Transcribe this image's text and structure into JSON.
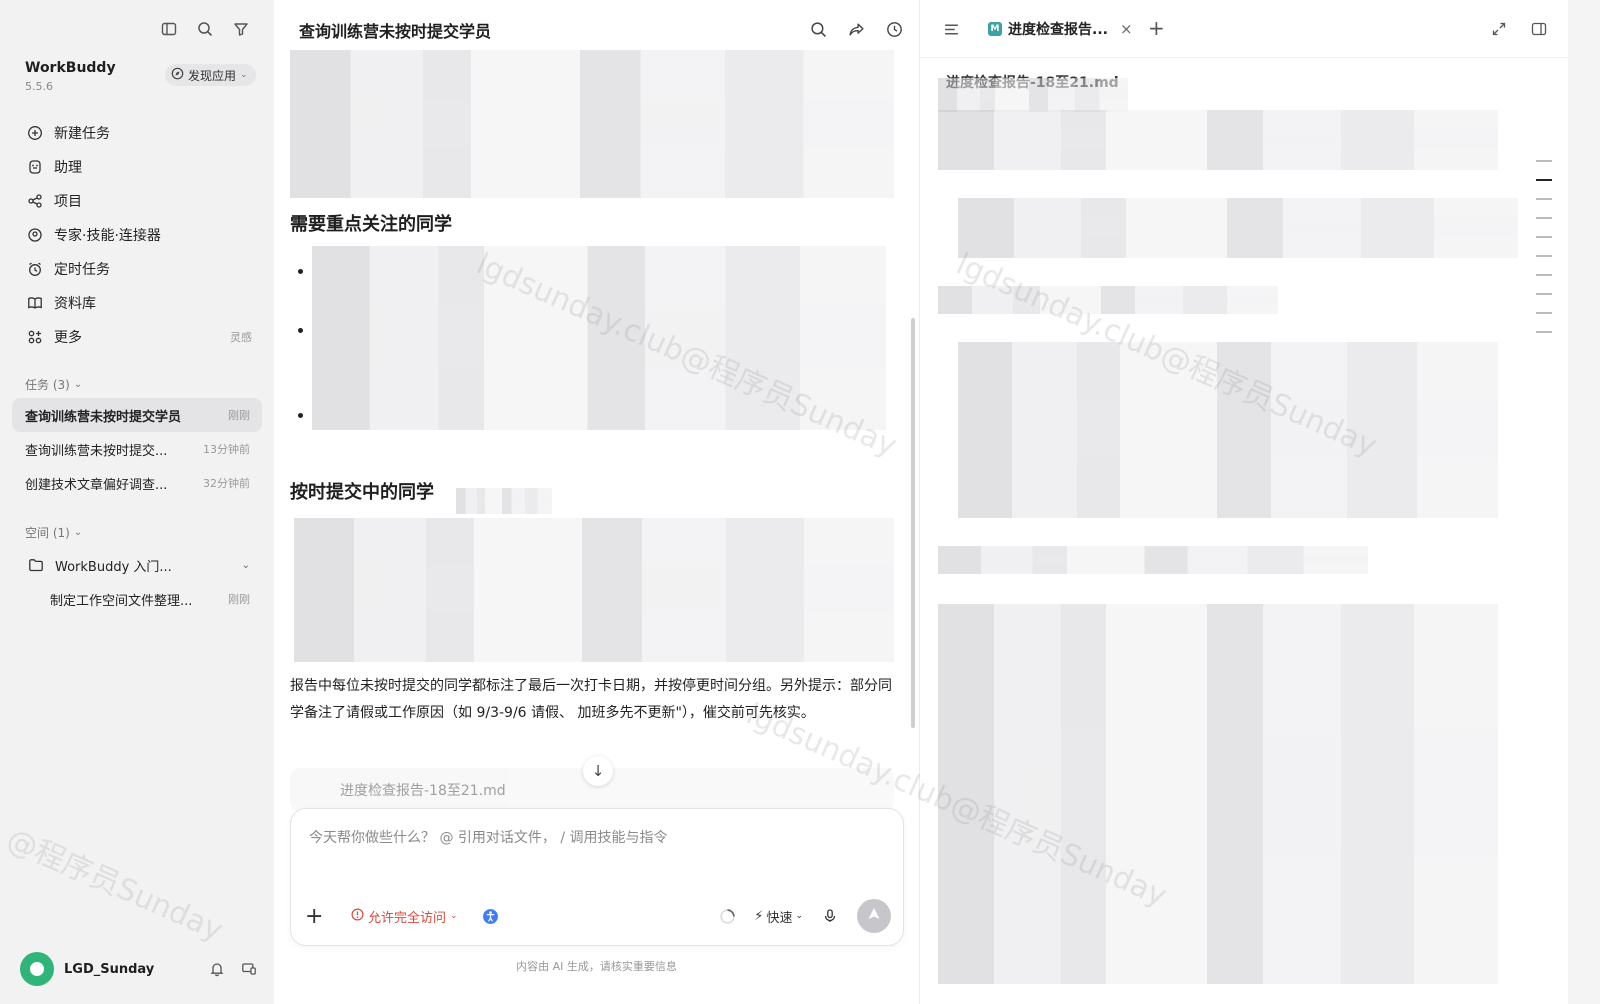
{
  "sidebar": {
    "app_name": "WorkBuddy",
    "version": "5.5.6",
    "discover_label": "发现应用",
    "nav": [
      {
        "label": "新建任务",
        "icon": "plus-circle-icon",
        "hint": ""
      },
      {
        "label": "助理",
        "icon": "assistant-icon",
        "hint": ""
      },
      {
        "label": "项目",
        "icon": "project-icon",
        "hint": ""
      },
      {
        "label": "专家·技能·连接器",
        "icon": "expert-icon",
        "hint": ""
      },
      {
        "label": "定时任务",
        "icon": "alarm-icon",
        "hint": ""
      },
      {
        "label": "资料库",
        "icon": "book-icon",
        "hint": ""
      },
      {
        "label": "更多",
        "icon": "more-apps-icon",
        "hint": "灵感"
      }
    ],
    "tasks_header": "任务 (3)",
    "tasks": [
      {
        "title": "查询训练营未按时提交学员",
        "time": "刚刚",
        "active": true
      },
      {
        "title": "查询训练营未按时提交...",
        "time": "13分钟前",
        "active": false
      },
      {
        "title": "创建技术文章偏好调查...",
        "time": "32分钟前",
        "active": false
      }
    ],
    "spaces_header": "空间 (1)",
    "space": {
      "title": "WorkBuddy 入门...",
      "child_title": "制定工作空间文件整理...",
      "child_time": "刚刚"
    },
    "user_name": "LGD_Sunday"
  },
  "chat": {
    "title": "查询训练营未按时提交学员",
    "heading_focus": "需要重点关注的同学",
    "heading_ontime": "按时提交中的同学",
    "summary": "报告中每位未按时提交的同学都标注了最后一次打卡日期，并按停更时间分组。另外提示：部分同学备注了请假或工作原因（如 9/3-9/6 请假、 加班多先不更新\"），催交前可先核实。",
    "file_card": "进度检查报告-18至21.md",
    "composer_placeholder": "今天帮你做些什么？ @ 引用对话文件， / 调用技能与指令",
    "access_label": "允许完全访问",
    "speed_label": "快速",
    "disclaimer": "内容由 AI 生成，请核实重要信息"
  },
  "doc": {
    "tab_label": "进度检查报告...",
    "filename": "进度检查报告-18至21.md"
  },
  "watermark": {
    "text_a": "lgdsunday.club@程序员Sunday",
    "text_b": "@程序员Sunday"
  }
}
